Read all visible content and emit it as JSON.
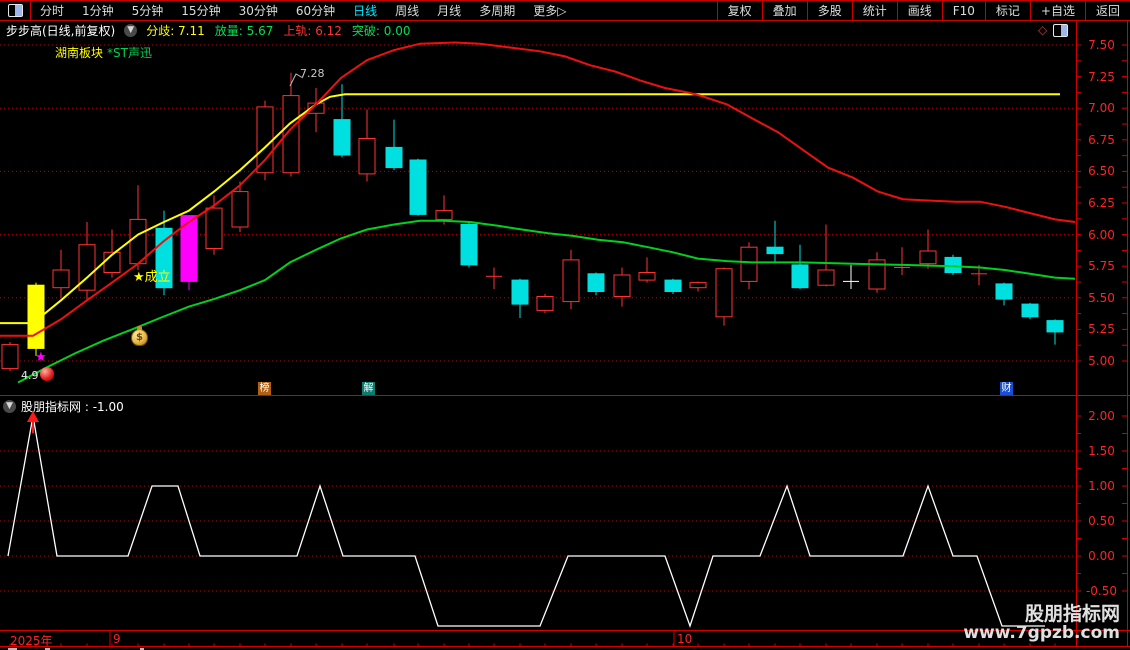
{
  "menu": {
    "left_items": [
      "分时",
      "1分钟",
      "5分钟",
      "15分钟",
      "30分钟",
      "60分钟",
      "日线",
      "周线",
      "月线",
      "多周期",
      "更多▷"
    ],
    "active_item": "日线",
    "right_items": [
      "复权",
      "叠加",
      "多股",
      "统计",
      "画线",
      "F10",
      "标记",
      "+自选",
      "返回"
    ]
  },
  "info_bar": {
    "title": "步步高(日线,前复权)",
    "fields": [
      {
        "label": "分歧:",
        "value": "7.11",
        "color": "#ffff00"
      },
      {
        "label": "放量:",
        "value": "5.67",
        "color": "#00e050"
      },
      {
        "label": "上轨:",
        "value": "6.12",
        "color": "#ff3232"
      },
      {
        "label": "突破:",
        "value": "0.00",
        "color": "#00e050"
      }
    ]
  },
  "tags": {
    "sector": "湖南板块",
    "related": "*ST声迅"
  },
  "annotations": {
    "peak_price": "7.28",
    "signal_text": "★成立",
    "star": "★",
    "low_value": "4.9",
    "badge_bang": "榜",
    "badge_jie": "解",
    "badge_cai": "财"
  },
  "sub_indicator": {
    "name": "股朋指标网",
    "value_label": " : -1.00"
  },
  "watermark": {
    "line1": "股朋指标网",
    "line2": "www.7gpzb.com"
  },
  "x_axis": {
    "year": "2025年",
    "ticks": [
      {
        "x": 110,
        "label": "9"
      },
      {
        "x": 674,
        "label": "10"
      }
    ]
  },
  "colors": {
    "up": "#ff3232",
    "down": "#00e0e0",
    "signal_yellow": "#ffff00",
    "signal_magenta": "#ff00ff",
    "doji_white": "#ffffff",
    "grid": "#c00000",
    "axis_text": "#ff2222",
    "active_tab": "#00e8ff"
  },
  "chart_data": [
    {
      "type": "candlestick",
      "panel": "main",
      "title": "步步高 日线 前复权",
      "y_axis": {
        "min": 5.0,
        "max": 7.5,
        "tick_step": 0.25,
        "grid_step": 0.5,
        "labels": [
          "7.50",
          "7.25",
          "7.00",
          "6.75",
          "6.50",
          "6.25",
          "6.00",
          "5.75",
          "5.50",
          "5.25",
          "5.00"
        ]
      },
      "candle_types": {
        "u": "up-hollow-red",
        "d": "down-filled-cyan",
        "y": "signal-yellow",
        "m": "signal-magenta",
        "x": "doji-red",
        "w": "doji-white"
      },
      "candles": [
        [
          10,
          4.94,
          5.15,
          4.92,
          5.13,
          "u"
        ],
        [
          36,
          5.1,
          5.62,
          5.04,
          5.6,
          "y"
        ],
        [
          61,
          5.58,
          5.88,
          5.5,
          5.72,
          "u"
        ],
        [
          87,
          5.56,
          6.1,
          5.48,
          5.92,
          "u"
        ],
        [
          112,
          5.7,
          6.04,
          5.66,
          5.86,
          "u"
        ],
        [
          138,
          5.77,
          6.39,
          5.72,
          6.12,
          "u"
        ],
        [
          164,
          6.05,
          6.19,
          5.52,
          5.58,
          "d"
        ],
        [
          189,
          5.63,
          6.15,
          5.56,
          6.15,
          "m"
        ],
        [
          214,
          5.89,
          6.31,
          5.84,
          6.21,
          "u"
        ],
        [
          240,
          6.06,
          6.42,
          6.02,
          6.34,
          "u"
        ],
        [
          265,
          6.49,
          7.06,
          6.43,
          7.01,
          "u"
        ],
        [
          291,
          6.49,
          7.28,
          6.46,
          7.1,
          "u"
        ],
        [
          316,
          6.96,
          7.16,
          6.81,
          7.04,
          "u"
        ],
        [
          342,
          6.91,
          7.19,
          6.61,
          6.63,
          "d"
        ],
        [
          367,
          6.48,
          6.99,
          6.42,
          6.76,
          "u"
        ],
        [
          394,
          6.69,
          6.91,
          6.51,
          6.53,
          "d"
        ],
        [
          418,
          6.59,
          6.6,
          6.15,
          6.16,
          "d"
        ],
        [
          444,
          6.12,
          6.31,
          6.08,
          6.19,
          "u"
        ],
        [
          469,
          6.08,
          6.1,
          5.74,
          5.76,
          "d"
        ],
        [
          494,
          5.66,
          5.74,
          5.57,
          5.67,
          "x"
        ],
        [
          520,
          5.64,
          5.65,
          5.34,
          5.45,
          "d"
        ],
        [
          545,
          5.4,
          5.53,
          5.38,
          5.51,
          "u"
        ],
        [
          571,
          5.47,
          5.88,
          5.41,
          5.8,
          "u"
        ],
        [
          596,
          5.69,
          5.7,
          5.52,
          5.55,
          "d"
        ],
        [
          622,
          5.51,
          5.74,
          5.43,
          5.68,
          "u"
        ],
        [
          647,
          5.64,
          5.82,
          5.62,
          5.7,
          "u"
        ],
        [
          673,
          5.64,
          5.65,
          5.53,
          5.55,
          "d"
        ],
        [
          698,
          5.58,
          5.63,
          5.55,
          5.62,
          "u"
        ],
        [
          724,
          5.35,
          5.74,
          5.28,
          5.73,
          "u"
        ],
        [
          749,
          5.63,
          5.94,
          5.57,
          5.9,
          "u"
        ],
        [
          775,
          5.9,
          6.11,
          5.78,
          5.85,
          "d"
        ],
        [
          800,
          5.76,
          5.92,
          5.57,
          5.58,
          "d"
        ],
        [
          826,
          5.6,
          6.08,
          5.59,
          5.72,
          "u"
        ],
        [
          851,
          5.63,
          5.76,
          5.57,
          5.63,
          "w"
        ],
        [
          877,
          5.57,
          5.86,
          5.54,
          5.8,
          "u"
        ],
        [
          902,
          5.73,
          5.9,
          5.68,
          5.74,
          "x"
        ],
        [
          928,
          5.77,
          6.04,
          5.73,
          5.87,
          "u"
        ],
        [
          953,
          5.82,
          5.84,
          5.68,
          5.7,
          "d"
        ],
        [
          979,
          5.69,
          5.76,
          5.6,
          5.69,
          "x"
        ],
        [
          1004,
          5.61,
          5.62,
          5.44,
          5.49,
          "d"
        ],
        [
          1030,
          5.45,
          5.46,
          5.33,
          5.35,
          "d"
        ],
        [
          1055,
          5.32,
          5.33,
          5.13,
          5.23,
          "d"
        ]
      ],
      "overlays": [
        {
          "name": "ma-green",
          "color": "#00d020",
          "points": [
            [
              18,
              4.83
            ],
            [
              47,
              4.95
            ],
            [
              75,
              5.06
            ],
            [
              103,
              5.16
            ],
            [
              132,
              5.25
            ],
            [
              160,
              5.34
            ],
            [
              189,
              5.43
            ],
            [
              214,
              5.49
            ],
            [
              240,
              5.56
            ],
            [
              265,
              5.64
            ],
            [
              290,
              5.78
            ],
            [
              316,
              5.88
            ],
            [
              341,
              5.97
            ],
            [
              367,
              6.04
            ],
            [
              394,
              6.08
            ],
            [
              420,
              6.11
            ],
            [
              443,
              6.11
            ],
            [
              470,
              6.1
            ],
            [
              498,
              6.07
            ],
            [
              522,
              6.04
            ],
            [
              548,
              6.01
            ],
            [
              573,
              5.99
            ],
            [
              598,
              5.96
            ],
            [
              623,
              5.94
            ],
            [
              648,
              5.9
            ],
            [
              673,
              5.86
            ],
            [
              698,
              5.81
            ],
            [
              727,
              5.79
            ],
            [
              752,
              5.78
            ],
            [
              803,
              5.78
            ],
            [
              853,
              5.77
            ],
            [
              903,
              5.76
            ],
            [
              953,
              5.75
            ],
            [
              980,
              5.74
            ],
            [
              1005,
              5.72
            ],
            [
              1030,
              5.69
            ],
            [
              1055,
              5.66
            ],
            [
              1075,
              5.65
            ]
          ]
        },
        {
          "name": "ma-yellow-divergence-7.11",
          "color": "#ffff00",
          "points": [
            [
              0,
              5.3
            ],
            [
              33,
              5.3
            ],
            [
              61,
              5.48
            ],
            [
              87,
              5.66
            ],
            [
              112,
              5.84
            ],
            [
              138,
              6.0
            ],
            [
              164,
              6.1
            ],
            [
              189,
              6.19
            ],
            [
              214,
              6.34
            ],
            [
              240,
              6.51
            ],
            [
              265,
              6.69
            ],
            [
              290,
              6.88
            ],
            [
              316,
              7.03
            ],
            [
              330,
              7.09
            ],
            [
              345,
              7.11
            ],
            [
              1060,
              7.11
            ]
          ]
        },
        {
          "name": "ma-red",
          "color": "#ee1010",
          "points": [
            [
              0,
              5.2
            ],
            [
              33,
              5.2
            ],
            [
              61,
              5.33
            ],
            [
              87,
              5.48
            ],
            [
              112,
              5.62
            ],
            [
              138,
              5.77
            ],
            [
              164,
              5.95
            ],
            [
              189,
              6.1
            ],
            [
              214,
              6.23
            ],
            [
              240,
              6.39
            ],
            [
              265,
              6.59
            ],
            [
              290,
              6.83
            ],
            [
              316,
              7.03
            ],
            [
              341,
              7.24
            ],
            [
              367,
              7.38
            ],
            [
              394,
              7.46
            ],
            [
              420,
              7.51
            ],
            [
              455,
              7.52
            ],
            [
              480,
              7.51
            ],
            [
              510,
              7.48
            ],
            [
              540,
              7.45
            ],
            [
              565,
              7.41
            ],
            [
              590,
              7.34
            ],
            [
              615,
              7.29
            ],
            [
              640,
              7.22
            ],
            [
              665,
              7.16
            ],
            [
              690,
              7.12
            ],
            [
              700,
              7.1
            ],
            [
              727,
              7.03
            ],
            [
              752,
              6.92
            ],
            [
              778,
              6.81
            ],
            [
              803,
              6.67
            ],
            [
              828,
              6.53
            ],
            [
              853,
              6.45
            ],
            [
              878,
              6.34
            ],
            [
              903,
              6.28
            ],
            [
              928,
              6.27
            ],
            [
              955,
              6.26
            ],
            [
              980,
              6.26
            ],
            [
              1005,
              6.22
            ],
            [
              1030,
              6.17
            ],
            [
              1055,
              6.12
            ],
            [
              1075,
              6.1
            ]
          ]
        }
      ]
    },
    {
      "type": "line",
      "panel": "sub",
      "name": "股朋指标网",
      "current_value": -1.0,
      "y_axis": {
        "min": -0.5,
        "max": 2.0,
        "tick_step": 0.5,
        "labels": [
          "2.00",
          "1.50",
          "1.00",
          "0.50",
          "0.00",
          "-0.50"
        ]
      },
      "series": [
        {
          "name": "indicator-step-line",
          "color": "#ffffff",
          "points": [
            [
              8,
              0
            ],
            [
              33,
              2
            ],
            [
              57,
              0
            ],
            [
              128,
              0
            ],
            [
              152,
              1
            ],
            [
              178,
              1
            ],
            [
              200,
              0
            ],
            [
              297,
              0
            ],
            [
              320,
              1
            ],
            [
              343,
              0
            ],
            [
              415,
              0
            ],
            [
              438,
              -1
            ],
            [
              540,
              -1
            ],
            [
              568,
              0
            ],
            [
              665,
              0
            ],
            [
              690,
              -1
            ],
            [
              713,
              0
            ],
            [
              760,
              0
            ],
            [
              787,
              1
            ],
            [
              810,
              0
            ],
            [
              903,
              0
            ],
            [
              928,
              1
            ],
            [
              953,
              0
            ],
            [
              977,
              0
            ],
            [
              1002,
              -1
            ],
            [
              1045,
              -1
            ]
          ]
        }
      ],
      "marker": {
        "type": "up-arrow",
        "color": "#ff1a1a",
        "x": 33,
        "value": 2.0
      }
    }
  ]
}
